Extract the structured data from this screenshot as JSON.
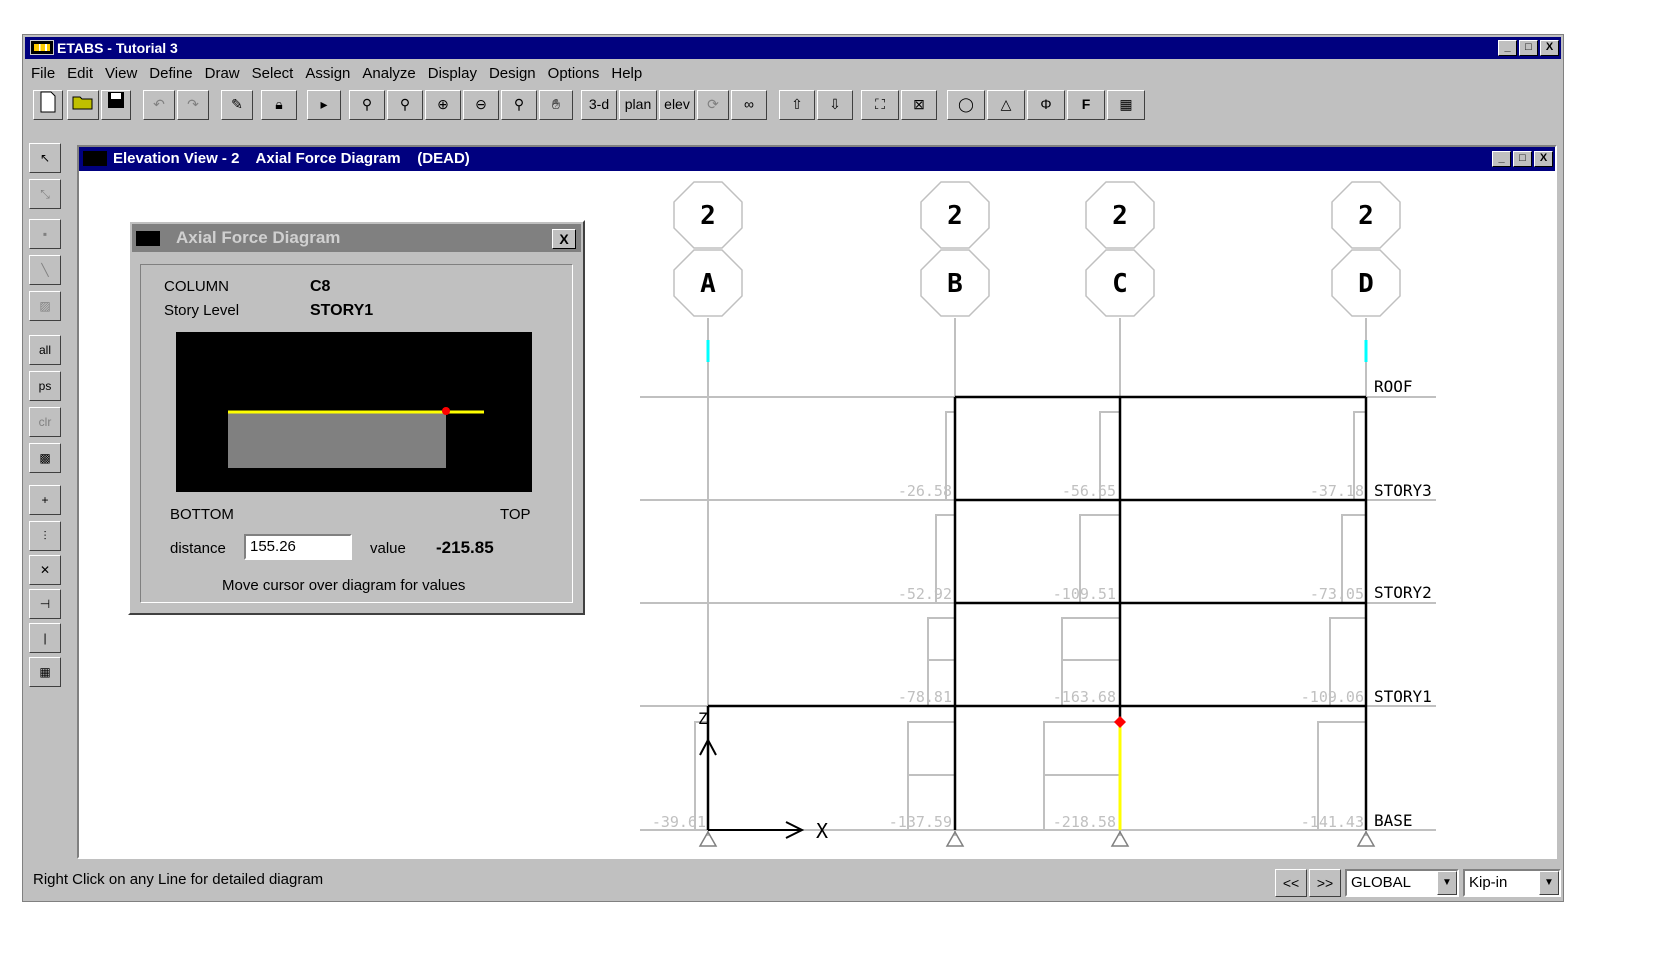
{
  "app": {
    "title": "ETABS - Tutorial 3",
    "window_buttons": [
      "_",
      "□",
      "X"
    ]
  },
  "menu": [
    "File",
    "Edit",
    "View",
    "Define",
    "Draw",
    "Select",
    "Assign",
    "Analyze",
    "Display",
    "Design",
    "Options",
    "Help"
  ],
  "toolbar": {
    "btn_3d": "3-d",
    "btn_plan": "plan",
    "btn_elev": "elev",
    "icons": [
      "new-file-icon",
      "open-folder-icon",
      "save-icon",
      "undo-icon",
      "redo-icon",
      "pencil-icon",
      "lock-icon",
      "pointer-play-icon",
      "zoom-window-icon",
      "zoom-restore-icon",
      "zoom-in-icon",
      "zoom-out-icon",
      "zoom-previous-icon",
      "pan-hand-icon",
      "rotate-icon",
      "perspective-icon",
      "move-up-icon",
      "move-down-icon",
      "object-shrink-icon",
      "set-elements-icon",
      "circle-icon",
      "triangle-icon",
      "phi-icon",
      "frame-f-icon",
      "table-icon"
    ]
  },
  "left_toolbar": {
    "all_label": "all",
    "ps_label": "ps",
    "clr_label": "clr"
  },
  "elevation": {
    "title": "Elevation View - 2    Axial Force Diagram    (DEAD)",
    "grid_top_labels": [
      "2",
      "2",
      "2",
      "2"
    ],
    "grid_labels": [
      "A",
      "B",
      "C",
      "D"
    ],
    "story_labels": [
      "ROOF",
      "STORY3",
      "STORY2",
      "STORY1",
      "BASE"
    ],
    "values": {
      "B_story3": "-26.58",
      "C_story3": "-56.65",
      "D_story3": "-37.18",
      "B_story2": "-52.92",
      "C_story2": "-109.51",
      "D_story2": "-73.05",
      "B_story1": "-78.81",
      "C_story1": "-163.68",
      "D_story1": "-109.06",
      "A_base": "-39.61",
      "B_base": "-137.59",
      "C_base": "-218.58",
      "D_base": "-141.43"
    },
    "axis_z": "Z",
    "axis_x": "X"
  },
  "dialog": {
    "title": "Axial Force Diagram",
    "close": "X",
    "column_label": "COLUMN",
    "column_value": "C8",
    "story_label": "Story Level",
    "story_value": "STORY1",
    "bottom_label": "BOTTOM",
    "top_label": "TOP",
    "distance_label": "distance",
    "distance_value": "155.26",
    "value_label": "value",
    "value_value": "-215.85",
    "hint": "Move cursor over diagram for values"
  },
  "status": {
    "text": "Right Click on any Line for detailed diagram",
    "prev": "<<",
    "next": ">>",
    "coord_system": "GLOBAL",
    "units": "Kip-in"
  },
  "colors": {
    "title_active": "#00007f",
    "title_inactive": "#808080",
    "highlight": "#ffff00",
    "marker": "#ff0000",
    "grid_line": "#c0c0c0",
    "cyan": "#00ffff"
  }
}
